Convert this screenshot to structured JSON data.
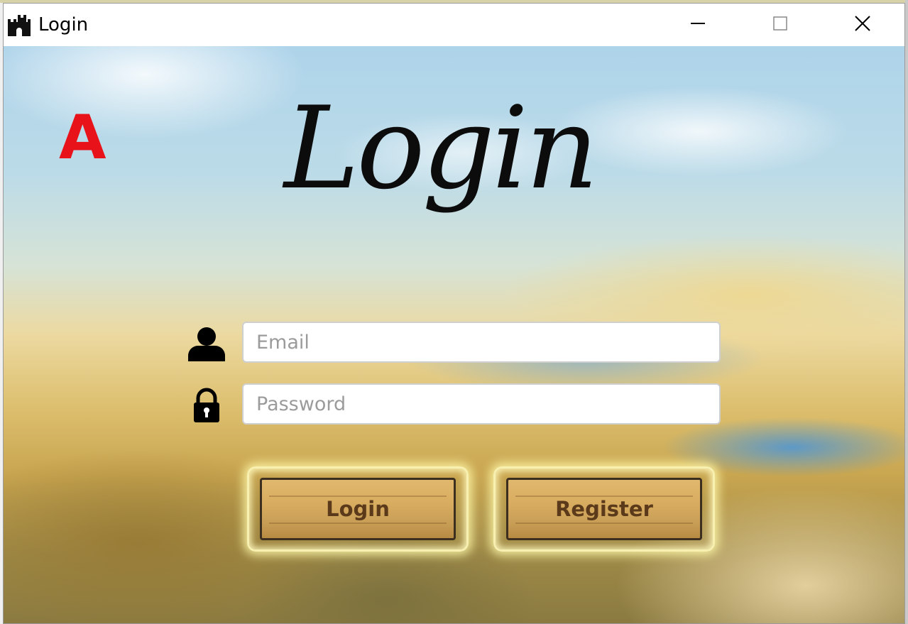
{
  "window": {
    "title": "Login"
  },
  "annotation": {
    "badge": "A",
    "badge_color": "#e8121b"
  },
  "login_form": {
    "heading": "Login",
    "email_placeholder": "Email",
    "email_value": "",
    "password_placeholder": "Password",
    "password_value": "",
    "login_button": "Login",
    "register_button": "Register"
  },
  "icons": {
    "app": "castle-icon",
    "minimize": "minimize-icon",
    "maximize": "maximize-icon",
    "close": "close-icon",
    "email": "user-icon",
    "password": "lock-icon"
  },
  "colors": {
    "button_text": "#5a3a1a",
    "button_glow": "#fff6a8",
    "heading": "#0c0c0c"
  }
}
